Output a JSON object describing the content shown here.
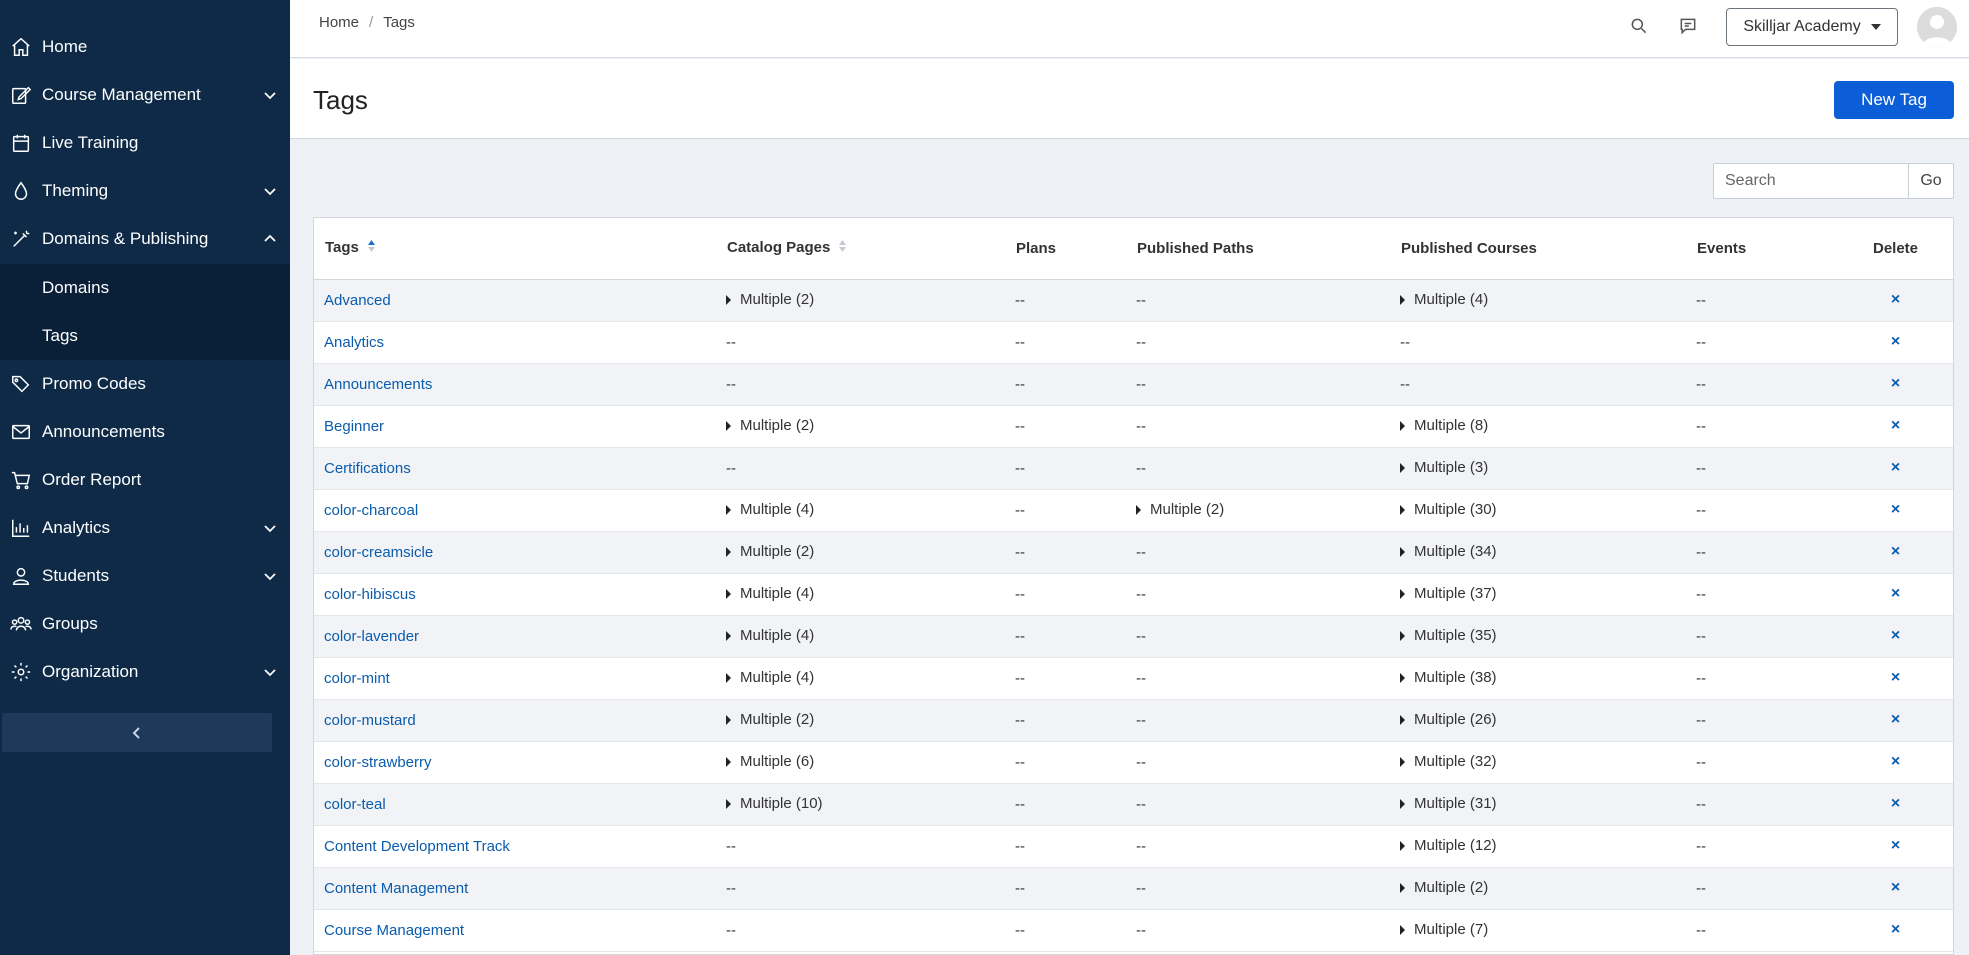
{
  "sidebar": {
    "items": [
      {
        "label": "Home",
        "icon": "home-icon"
      },
      {
        "label": "Course Management",
        "icon": "edit-icon"
      },
      {
        "label": "Live Training",
        "icon": "calendar-icon"
      },
      {
        "label": "Theming",
        "icon": "droplet-icon"
      },
      {
        "label": "Domains & Publishing",
        "icon": "magic-wand-icon"
      },
      {
        "label": "Promo Codes",
        "icon": "tags-icon"
      },
      {
        "label": "Announcements",
        "icon": "envelope-icon"
      },
      {
        "label": "Order Report",
        "icon": "cart-icon"
      },
      {
        "label": "Analytics",
        "icon": "bar-chart-icon"
      },
      {
        "label": "Students",
        "icon": "person-icon"
      },
      {
        "label": "Groups",
        "icon": "people-icon"
      },
      {
        "label": "Organization",
        "icon": "gear-icon"
      }
    ],
    "subitems": [
      {
        "label": "Domains"
      },
      {
        "label": "Tags"
      }
    ]
  },
  "topbar": {
    "breadcrumb": [
      "Home",
      "Tags"
    ],
    "org_name": "Skilljar Academy"
  },
  "header": {
    "title": "Tags",
    "new_button": "New Tag"
  },
  "search": {
    "placeholder": "Search",
    "go_label": "Go"
  },
  "table": {
    "columns": [
      "Tags",
      "Catalog Pages",
      "Plans",
      "Published Paths",
      "Published Courses",
      "Events",
      "Delete"
    ],
    "rows": [
      {
        "tag": "Advanced",
        "catalog": "Multiple (2)",
        "plans": "--",
        "paths": "--",
        "courses": "Multiple (4)",
        "events": "--",
        "delete": "×"
      },
      {
        "tag": "Analytics",
        "catalog": "--",
        "plans": "--",
        "paths": "--",
        "courses": "--",
        "events": "--",
        "delete": "×"
      },
      {
        "tag": "Announcements",
        "catalog": "--",
        "plans": "--",
        "paths": "--",
        "courses": "--",
        "events": "--",
        "delete": "×"
      },
      {
        "tag": "Beginner",
        "catalog": "Multiple (2)",
        "plans": "--",
        "paths": "--",
        "courses": "Multiple (8)",
        "events": "--",
        "delete": "×"
      },
      {
        "tag": "Certifications",
        "catalog": "--",
        "plans": "--",
        "paths": "--",
        "courses": "Multiple (3)",
        "events": "--",
        "delete": "×"
      },
      {
        "tag": "color-charcoal",
        "catalog": "Multiple (4)",
        "plans": "--",
        "paths": "Multiple (2)",
        "courses": "Multiple (30)",
        "events": "--",
        "delete": "×"
      },
      {
        "tag": "color-creamsicle",
        "catalog": "Multiple (2)",
        "plans": "--",
        "paths": "--",
        "courses": "Multiple (34)",
        "events": "--",
        "delete": "×"
      },
      {
        "tag": "color-hibiscus",
        "catalog": "Multiple (4)",
        "plans": "--",
        "paths": "--",
        "courses": "Multiple (37)",
        "events": "--",
        "delete": "×"
      },
      {
        "tag": "color-lavender",
        "catalog": "Multiple (4)",
        "plans": "--",
        "paths": "--",
        "courses": "Multiple (35)",
        "events": "--",
        "delete": "×"
      },
      {
        "tag": "color-mint",
        "catalog": "Multiple (4)",
        "plans": "--",
        "paths": "--",
        "courses": "Multiple (38)",
        "events": "--",
        "delete": "×"
      },
      {
        "tag": "color-mustard",
        "catalog": "Multiple (2)",
        "plans": "--",
        "paths": "--",
        "courses": "Multiple (26)",
        "events": "--",
        "delete": "×"
      },
      {
        "tag": "color-strawberry",
        "catalog": "Multiple (6)",
        "plans": "--",
        "paths": "--",
        "courses": "Multiple (32)",
        "events": "--",
        "delete": "×"
      },
      {
        "tag": "color-teal",
        "catalog": "Multiple (10)",
        "plans": "--",
        "paths": "--",
        "courses": "Multiple (31)",
        "events": "--",
        "delete": "×"
      },
      {
        "tag": "Content Development Track",
        "catalog": "--",
        "plans": "--",
        "paths": "--",
        "courses": "Multiple (12)",
        "events": "--",
        "delete": "×"
      },
      {
        "tag": "Content Management",
        "catalog": "--",
        "plans": "--",
        "paths": "--",
        "courses": "Multiple (2)",
        "events": "--",
        "delete": "×"
      },
      {
        "tag": "Course Management",
        "catalog": "--",
        "plans": "--",
        "paths": "--",
        "courses": "Multiple (7)",
        "events": "--",
        "delete": "×"
      }
    ]
  },
  "colors": {
    "sidebar_bg": "#0e2a47",
    "primary": "#0b5ed7",
    "link": "#0b5cad"
  }
}
